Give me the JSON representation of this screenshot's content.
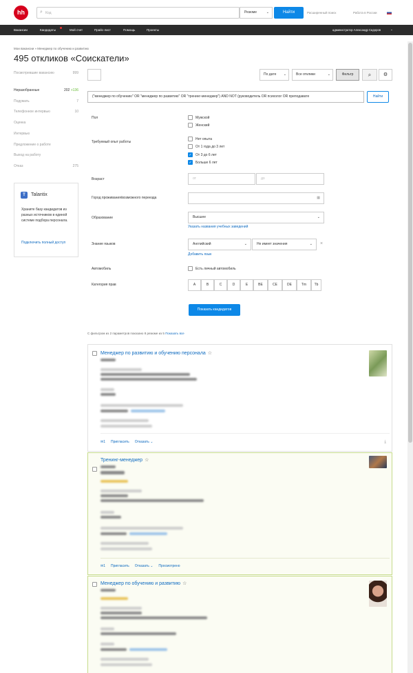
{
  "header": {
    "logo": "hh",
    "search_placeholder": "Код",
    "search_type": "Резюме",
    "find": "Найти",
    "advanced": "Расширенный поиск",
    "work_in_russia": "Работа в России"
  },
  "nav": {
    "items": [
      "Вакансии",
      "Кандидаты",
      "Мой счет",
      "Прайс-лист",
      "Помощь",
      "Проекты"
    ],
    "user": "администратор Александр Сидоров"
  },
  "breadcrumb": "Мои вакансии » Менеджер по обучению и развитию",
  "page_title": "495 откликов «Соискатели»",
  "sidebar": [
    {
      "label": "Посмотревшие вакансию",
      "count": "999"
    },
    {
      "label": "Неразобранные",
      "count": "202",
      "extra": "+136"
    },
    {
      "label": "Подумать",
      "count": "7"
    },
    {
      "label": "Телефонное интервью",
      "count": "10"
    },
    {
      "label": "Оценка",
      "count": ""
    },
    {
      "label": "Интервью",
      "count": ""
    },
    {
      "label": "Предложение о работе",
      "count": ""
    },
    {
      "label": "Выход на работу",
      "count": ""
    },
    {
      "label": "Отказ",
      "count": "275"
    }
  ],
  "talantix": {
    "name": "Talantix",
    "text": "Храните базу кандидатов из разных источников в единой системе подбора персонала.",
    "link": "Подключить полный доступ"
  },
  "toolbar": {
    "sort": "По дате",
    "filter_all": "Все отклики",
    "filter": "Фильтр"
  },
  "query": "(\"менеджер по обучению\" OR \"менеджер по развитию\" OR \"тренинг-менеджер\") AND NOT (руководитель OR психолог OR преподавате",
  "query_find": "Найти",
  "filters": {
    "gender_label": "Пол",
    "gender": [
      "Мужской",
      "Женский"
    ],
    "exp_label": "Требуемый опыт работы",
    "exp": [
      "Нет опыта",
      "От 1 года до 3 лет",
      "От 3 до 6 лет",
      "Больше 6 лет"
    ],
    "age_label": "Возраст",
    "age_from": "от",
    "age_to": "до",
    "city_label": "Город проживания/возможного переезда",
    "edu_label": "Образование",
    "edu_value": "Высшее",
    "edu_link": "Указать названия учебных заведений",
    "lang_label": "Знание языков",
    "lang_value": "Английский",
    "lang_level": "Не имеет значения",
    "lang_link": "Добавить язык",
    "car_label": "Автомобиль",
    "car_opt": "Есть личный автомобиль",
    "license_label": "Категория прав",
    "licenses": [
      "A",
      "B",
      "C",
      "D",
      "E",
      "BE",
      "CE",
      "DE",
      "Tm",
      "Tb"
    ],
    "show_btn": "Показать кандидатов"
  },
  "summary": "С фильтром из 2 параметров показано 8 резюме из 5",
  "summary_link": "Показать все",
  "cards": [
    {
      "title": "Менеджер по развитию и обучению персонала",
      "foot": [
        "Пригласить",
        "Отказать ⌄"
      ]
    },
    {
      "title": "Тренинг-менеджер",
      "foot": [
        "Пригласить",
        "Отказать ⌄",
        "Просмотрено"
      ]
    },
    {
      "title": "Менеджер по обучению и развитию",
      "foot": []
    }
  ],
  "colors": {
    "accent": "#0d88e7",
    "brand": "#d6001c",
    "link": "#0d6ac0"
  }
}
